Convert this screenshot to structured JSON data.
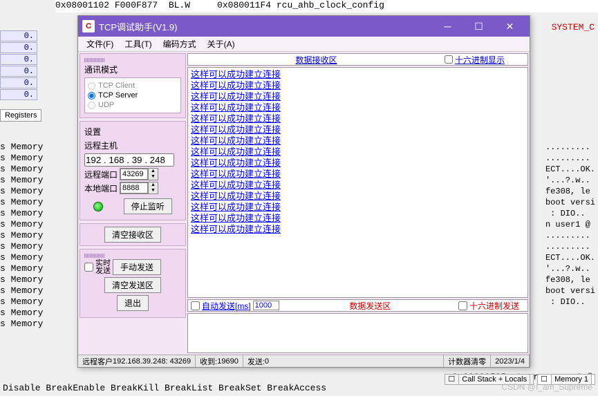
{
  "bg": {
    "asm_line": "0x08001102 F000F877  BL.W     0x080011F4 rcu_ahb_clock_config",
    "red_text": "SYSTEM_C",
    "left_vals": [
      "0.",
      "0.",
      "0.",
      "0.",
      "0.",
      "0."
    ],
    "registers_tab": "Registers",
    "memory_lines": [
      "s Memory",
      "s Memory",
      "s Memory",
      "s Memory",
      "s Memory",
      "s Memory",
      "s Memory",
      "s Memory",
      "s Memory",
      "s Memory",
      "s Memory",
      "s Memory",
      "s Memory",
      "s Memory",
      "s Memory",
      "s Memory",
      "s Memory"
    ],
    "right_lines": [
      ".........",
      ".........",
      "ECT....OK.",
      "'...?.w..",
      "fe308, le",
      "boot versi",
      " : DIO..",
      "n user1 @ ",
      ".........",
      ".........",
      "ECT....OK.",
      "'...?.w..",
      "fe308, le",
      "boot versi",
      " : DIO.."
    ],
    "bottom_addr": "0x20000585: to run user1 @",
    "bottom_break": "Disable BreakEnable BreakKill BreakList BreakSet BreakAccess",
    "tab_callstack": "Call Stack + Locals",
    "tab_memory": "Memory 1",
    "watermark": "CSDN @I_am_Supreme"
  },
  "tcp": {
    "title": "TCP调试助手(V1.9)",
    "app_icon": "C",
    "menu": {
      "file": "文件(F)",
      "tool": "工具(T)",
      "encoding": "编码方式",
      "about": "关于(A)"
    },
    "comm_mode": {
      "label": "通讯模式",
      "opt_client": "TCP Client",
      "opt_server": "TCP Server",
      "opt_udp": "UDP"
    },
    "settings": {
      "label": "设置",
      "remote_host_lbl": "远程主机",
      "remote_host": "192 . 168 . 39 . 248",
      "remote_port_lbl": "远程端口",
      "remote_port": "43269",
      "local_port_lbl": "本地端口",
      "local_port": "8888",
      "stop_listen": "停止监听"
    },
    "clear_rx": "清空接收区",
    "realtime_label": "实时\n发送",
    "manual_send": "手动发送",
    "clear_tx": "清空发送区",
    "exit": "退出",
    "rx_header": {
      "title": "数据接收区",
      "hex": "十六进制显示"
    },
    "rx_line": "这样可以成功建立连接",
    "rx_count": 15,
    "tx_header": {
      "auto": "自动发送[ms]",
      "ms": "1000",
      "title": "数据发送区",
      "hex": "十六进制发送"
    },
    "status": {
      "client_lbl": "远程客户",
      "client": "192.168.39.248: 43269",
      "recv_lbl": "收到:",
      "recv": "19690",
      "send_lbl": "发送:",
      "send": "0",
      "counter_clear": "计数器清零",
      "date": "2023/1/4"
    }
  }
}
